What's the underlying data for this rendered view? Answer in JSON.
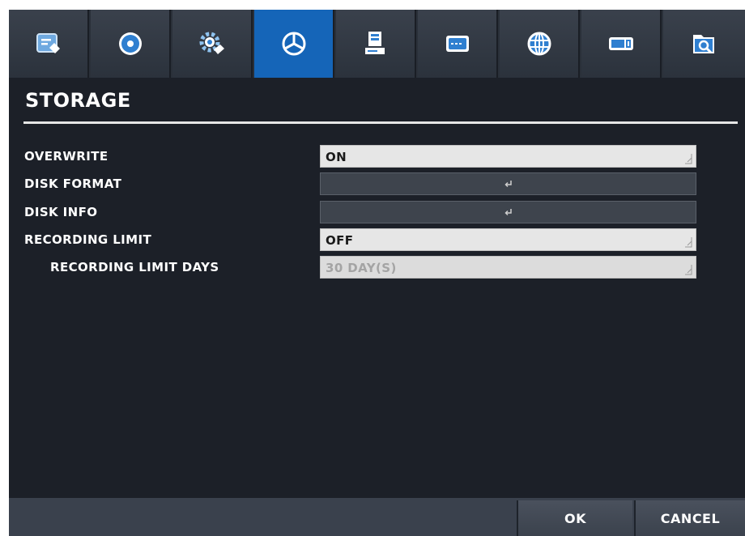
{
  "tabs": [
    {
      "icon": "system-info-icon",
      "active": false
    },
    {
      "icon": "record-disc-icon",
      "active": false
    },
    {
      "icon": "settings-gear-icon",
      "active": false
    },
    {
      "icon": "storage-pie-icon",
      "active": true
    },
    {
      "icon": "device-icon",
      "active": false
    },
    {
      "icon": "keyboard-icon",
      "active": false
    },
    {
      "icon": "network-globe-icon",
      "active": false
    },
    {
      "icon": "event-icon",
      "active": false
    },
    {
      "icon": "search-icon",
      "active": false
    }
  ],
  "page": {
    "title": "STORAGE"
  },
  "settings": {
    "overwrite": {
      "label": "OVERWRITE",
      "value": "ON"
    },
    "disk_format": {
      "label": "DISK FORMAT"
    },
    "disk_info": {
      "label": "DISK INFO"
    },
    "recording_limit": {
      "label": "RECORDING LIMIT",
      "value": "OFF"
    },
    "recording_limit_days": {
      "label": "RECORDING LIMIT DAYS",
      "value": "30 DAY(S)"
    }
  },
  "footer": {
    "ok_label": "OK",
    "cancel_label": "CANCEL"
  },
  "colors": {
    "active_tab": "#1565b8",
    "background": "#1c2028",
    "field": "#e6e6e6"
  }
}
